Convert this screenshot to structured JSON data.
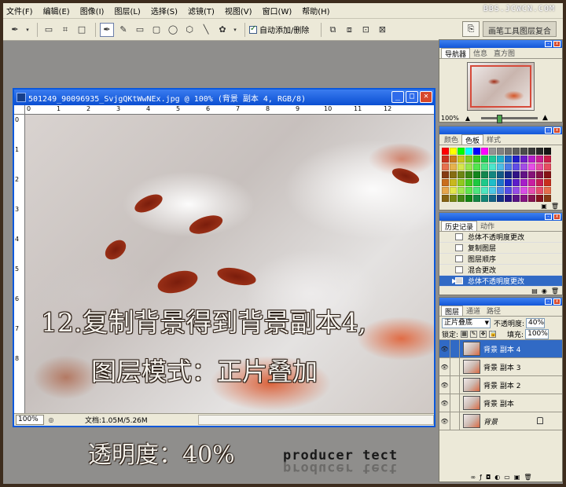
{
  "app": {
    "watermark": "BBS.JCWCN.COM",
    "menu": [
      "文件(F)",
      "编辑(E)",
      "图像(I)",
      "图层(L)",
      "选择(S)",
      "滤镜(T)",
      "视图(V)",
      "窗口(W)",
      "帮助(H)"
    ]
  },
  "options_bar": {
    "auto_add_delete_label": "自动添加/删除",
    "auto_add_delete_checked": true,
    "workspace_tab": "画笔工具图层复合"
  },
  "document": {
    "title": "501249_90096935_SvjgQKtWwNEx.jpg @ 100% (背景 副本 4, RGB/8)",
    "ruler_h": [
      "0",
      "1",
      "2",
      "3",
      "4",
      "5",
      "6",
      "7",
      "8",
      "9",
      "10",
      "11",
      "12"
    ],
    "ruler_v": [
      "0",
      "1",
      "2",
      "3",
      "4",
      "5",
      "6",
      "7",
      "8"
    ],
    "zoom": "100%",
    "doc_info": "文档:1.05M/5.26M",
    "overlay_line1": "12.复制背景得到背景副本4,",
    "overlay_line2": "图层模式：正片叠加"
  },
  "caption": {
    "opacity_text": "透明度：40%",
    "signature": "producer tect"
  },
  "navigator": {
    "tabs": [
      "导航器",
      "信息",
      "直方图"
    ],
    "active_tab": 0,
    "zoom": "100%"
  },
  "color_panel": {
    "tabs": [
      "颜色",
      "色板",
      "样式"
    ],
    "active_tab": 1
  },
  "history": {
    "tabs": [
      "历史记录",
      "动作"
    ],
    "active_tab": 0,
    "items": [
      "总体不透明度更改",
      "复制图层",
      "图层顺序",
      "混合更改",
      "总体不透明度更改"
    ],
    "selected_index": 4
  },
  "layers": {
    "tabs": [
      "图层",
      "通道",
      "路径"
    ],
    "active_tab": 0,
    "blend_mode": "正片叠底",
    "opacity_label": "不透明度:",
    "opacity": "40%",
    "lock_label": "锁定:",
    "fill_label": "填充:",
    "fill": "100%",
    "items": [
      {
        "name": "背景 副本 4",
        "selected": true,
        "locked": false,
        "italic": false
      },
      {
        "name": "背景 副本 3",
        "selected": false,
        "locked": false,
        "italic": false
      },
      {
        "name": "背景 副本 2",
        "selected": false,
        "locked": false,
        "italic": false
      },
      {
        "name": "背景 副本",
        "selected": false,
        "locked": false,
        "italic": false
      },
      {
        "name": "背景",
        "selected": false,
        "locked": true,
        "italic": true
      }
    ]
  },
  "colors": {
    "titlebar_blue": "#0b4fd2",
    "selection_blue": "#316ac5",
    "frame_brown": "#3d2c1d",
    "workspace_gray": "#8f8e8c"
  }
}
